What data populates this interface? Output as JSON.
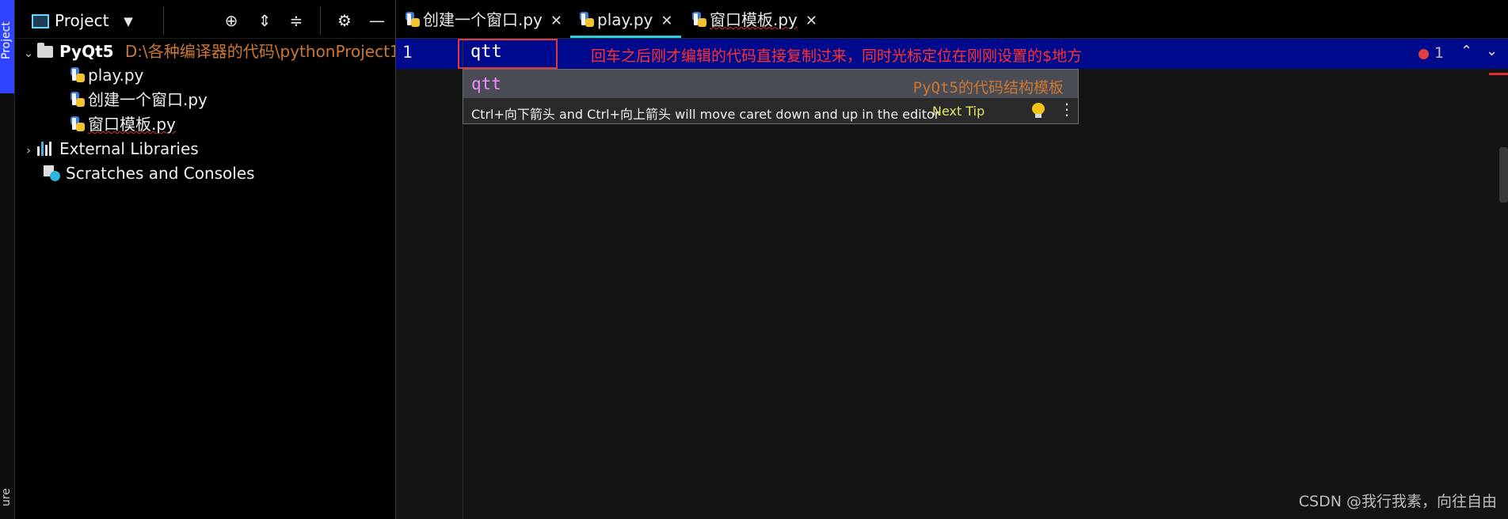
{
  "left_strip": {
    "project_label": "Project",
    "bottom_label": "ure"
  },
  "project_panel": {
    "title": "Project",
    "root": {
      "name": "PyQt5",
      "path": "D:\\各种编译器的代码\\pythonProject1"
    },
    "files": [
      "play.py",
      "创建一个窗口.py",
      "窗口模板.py"
    ],
    "external_libraries": "External Libraries",
    "scratches": "Scratches and Consoles"
  },
  "tabs": [
    {
      "label": "创建一个窗口.py",
      "active": false
    },
    {
      "label": "play.py",
      "active": true
    },
    {
      "label": "窗口模板.py",
      "active": false
    }
  ],
  "editor": {
    "line_number": "1",
    "code": "qtt",
    "annotation": "回车之后刚才编辑的代码直接复制过来，同时光标定位在刚刚设置的$地方",
    "problem_count": "1"
  },
  "completion": {
    "name": "qtt",
    "description": "PyQt5的代码结构模板",
    "tip": "Ctrl+向下箭头 and Ctrl+向上箭头 will move caret down and up in the editor",
    "next_tip": "Next Tip"
  },
  "watermark": "CSDN @我行我素，向往自由",
  "colors": {
    "accent": "#2ad0d8",
    "caret_line": "#000a8c",
    "error": "#e33838",
    "path": "#cc7832"
  }
}
